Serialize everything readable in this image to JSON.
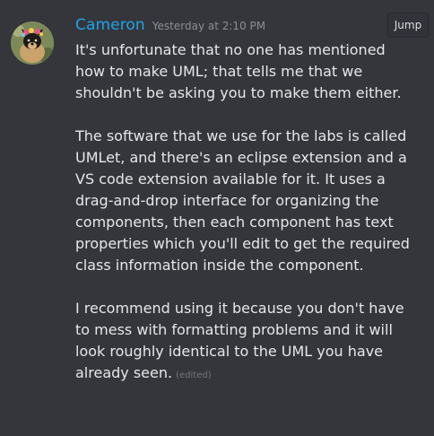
{
  "message": {
    "author": "Cameron",
    "timestamp": "Yesterday at 2:10 PM",
    "jump_label": "Jump",
    "edited_label": "(edited)",
    "paragraphs": [
      [
        "It's unfortunate that no one has mentioned",
        "how to make UML; that tells me that we",
        "shouldn't be asking you to make them either."
      ],
      [
        "The software that we use for the labs is called",
        "UMLet, and there's an eclipse extension and a",
        "VS code extension available for it. It uses a",
        "drag-and-drop interface for organizing the",
        "components, then each component has text",
        "properties which you'll edit to get the required",
        "class information inside the component."
      ],
      [
        "I recommend using it because you don't have",
        "to mess with formatting problems and it will",
        "look roughly identical to the UML you have",
        "already seen."
      ]
    ]
  },
  "colors": {
    "background": "#35363c",
    "username": "#1ea4e9",
    "text": "#e6e7e8",
    "timestamp": "#8b8e94",
    "edited": "#72767d"
  },
  "icons": {
    "avatar": "dog-avatar"
  }
}
